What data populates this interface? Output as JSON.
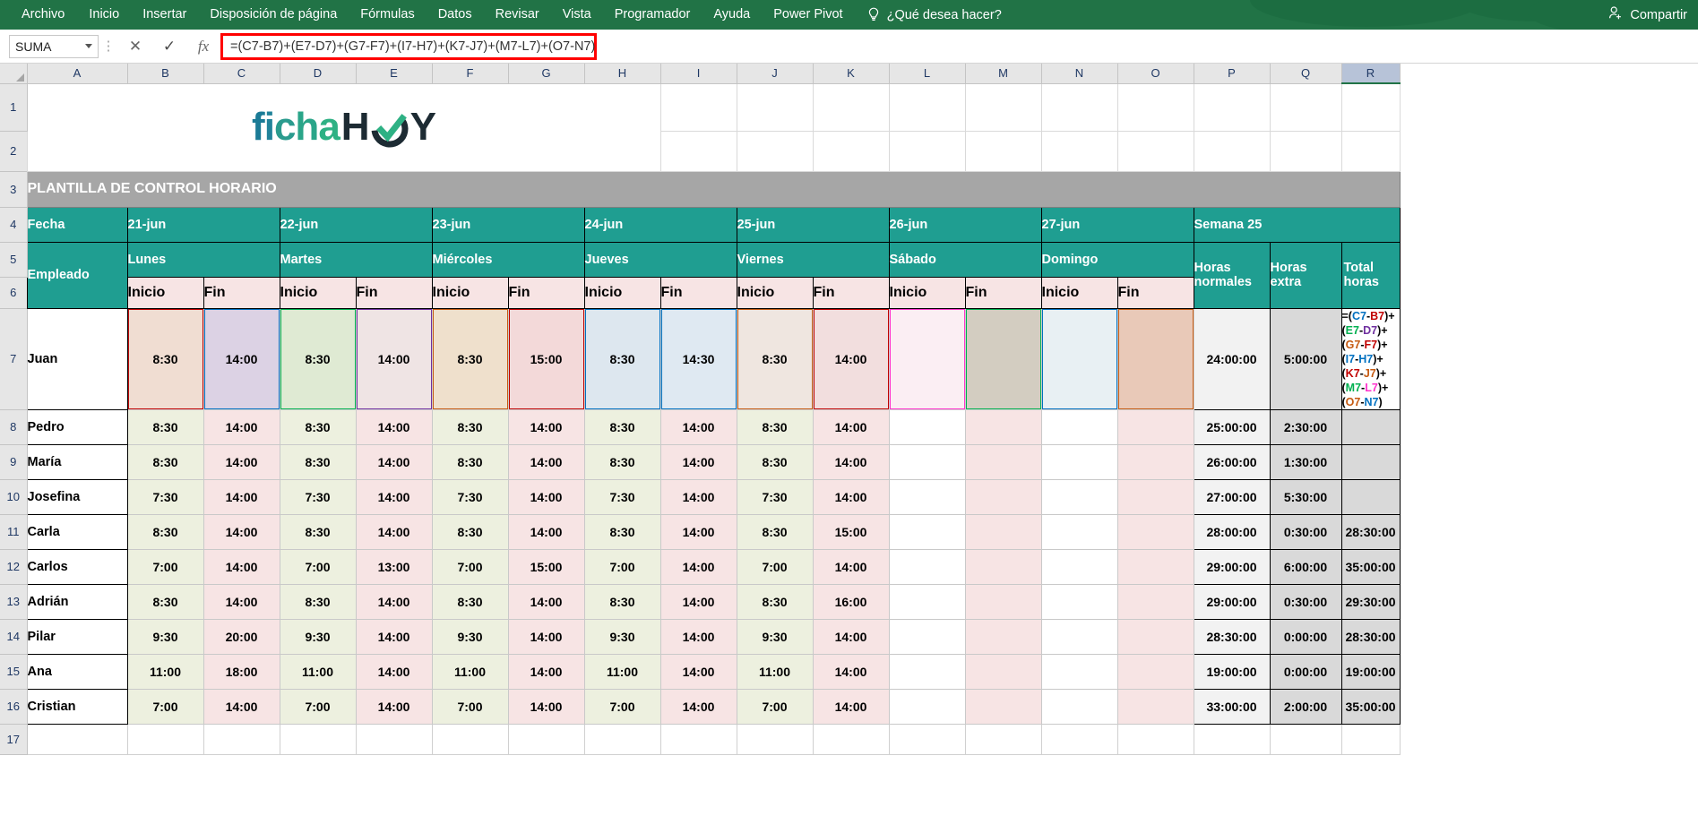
{
  "ribbon": {
    "tabs": [
      "Archivo",
      "Inicio",
      "Insertar",
      "Disposición de página",
      "Fórmulas",
      "Datos",
      "Revisar",
      "Vista",
      "Programador",
      "Ayuda",
      "Power Pivot"
    ],
    "tell_me": "¿Qué desea hacer?",
    "bulb_icon": "lightbulb-icon",
    "share_label": "Compartir",
    "share_icon": "person-add-icon",
    "accent_color": "#217346"
  },
  "formula_bar": {
    "name_box_value": "SUMA",
    "cancel_icon": "cancel-x-icon",
    "confirm_icon": "confirm-check-icon",
    "function_icon": "insert-function-icon",
    "formula": "=(C7-B7)+(E7-D7)+(G7-F7)+(I7-H7)+(K7-J7)+(M7-L7)+(O7-N7)",
    "highlight_color": "#ff0000"
  },
  "grid": {
    "columns": [
      "A",
      "B",
      "C",
      "D",
      "E",
      "F",
      "G",
      "H",
      "I",
      "J",
      "K",
      "L",
      "M",
      "N",
      "O",
      "P",
      "Q",
      "R"
    ],
    "selected_column": "R",
    "rows": [
      "1",
      "2",
      "3",
      "4",
      "5",
      "6",
      "7",
      "8",
      "9",
      "10",
      "11",
      "12",
      "13",
      "14",
      "15",
      "16",
      "17"
    ]
  },
  "sheet": {
    "logo": {
      "text_light": "ficha",
      "text_dark": "H",
      "text_mark": "O",
      "text_end": "Y"
    },
    "title": "PLANTILLA DE CONTROL HORARIO",
    "header_row_date_label": "Fecha",
    "header_row_employee_label": "Empleado",
    "dates": [
      "21-jun",
      "22-jun",
      "23-jun",
      "24-jun",
      "25-jun",
      "26-jun",
      "27-jun"
    ],
    "weekdays": [
      "Lunes",
      "Martes",
      "Miércoles",
      "Jueves",
      "Viernes",
      "Sábado",
      "Domingo"
    ],
    "week_label": "Semana 25",
    "subheaders": [
      "Inicio",
      "Fin"
    ],
    "summary_headers": [
      "Horas normales",
      "Horas extra",
      "Total horas"
    ],
    "r7_formula_parts": [
      {
        "t": "=(",
        "c": "#000000"
      },
      {
        "t": "C7",
        "c": "#0070c0"
      },
      {
        "t": "-",
        "c": "#000000"
      },
      {
        "t": "B7",
        "c": "#c00000"
      },
      {
        "t": ")+(",
        "c": "#000000"
      },
      {
        "t": "E7",
        "c": "#00b050"
      },
      {
        "t": "-",
        "c": "#000000"
      },
      {
        "t": "D7",
        "c": "#7030a0"
      },
      {
        "t": ")+(",
        "c": "#000000"
      },
      {
        "t": "G7",
        "c": "#c55a11"
      },
      {
        "t": "-",
        "c": "#000000"
      },
      {
        "t": "F7",
        "c": "#c00000"
      },
      {
        "t": ")+(",
        "c": "#000000"
      },
      {
        "t": "I7",
        "c": "#0070c0"
      },
      {
        "t": "-",
        "c": "#000000"
      },
      {
        "t": "H7",
        "c": "#0070c0"
      },
      {
        "t": ")+(",
        "c": "#000000"
      },
      {
        "t": "K7",
        "c": "#c00000"
      },
      {
        "t": "-",
        "c": "#000000"
      },
      {
        "t": "J7",
        "c": "#c55a11"
      },
      {
        "t": ")+(",
        "c": "#000000"
      },
      {
        "t": "M7",
        "c": "#00b050"
      },
      {
        "t": "-",
        "c": "#000000"
      },
      {
        "t": "L7",
        "c": "#ff33cc"
      },
      {
        "t": ")+(",
        "c": "#000000"
      },
      {
        "t": "O7",
        "c": "#c55a11"
      },
      {
        "t": "-",
        "c": "#000000"
      },
      {
        "t": "N7",
        "c": "#0070c0"
      },
      {
        "t": ")",
        "c": "#000000"
      }
    ],
    "employees": [
      {
        "name": "Juan",
        "times": [
          "8:30",
          "14:00",
          "8:30",
          "14:00",
          "8:30",
          "15:00",
          "8:30",
          "14:30",
          "8:30",
          "14:00",
          "",
          "",
          "",
          ""
        ],
        "normales": "24:00:00",
        "extra": "5:00:00",
        "total": ""
      },
      {
        "name": "Pedro",
        "times": [
          "8:30",
          "14:00",
          "8:30",
          "14:00",
          "8:30",
          "14:00",
          "8:30",
          "14:00",
          "8:30",
          "14:00",
          "",
          "",
          "",
          ""
        ],
        "normales": "25:00:00",
        "extra": "2:30:00",
        "total": ""
      },
      {
        "name": "María",
        "times": [
          "8:30",
          "14:00",
          "8:30",
          "14:00",
          "8:30",
          "14:00",
          "8:30",
          "14:00",
          "8:30",
          "14:00",
          "",
          "",
          "",
          ""
        ],
        "normales": "26:00:00",
        "extra": "1:30:00",
        "total": ""
      },
      {
        "name": "Josefina",
        "times": [
          "7:30",
          "14:00",
          "7:30",
          "14:00",
          "7:30",
          "14:00",
          "7:30",
          "14:00",
          "7:30",
          "14:00",
          "",
          "",
          "",
          ""
        ],
        "normales": "27:00:00",
        "extra": "5:30:00",
        "total": ""
      },
      {
        "name": "Carla",
        "times": [
          "8:30",
          "14:00",
          "8:30",
          "14:00",
          "8:30",
          "14:00",
          "8:30",
          "14:00",
          "8:30",
          "15:00",
          "",
          "",
          "",
          ""
        ],
        "normales": "28:00:00",
        "extra": "0:30:00",
        "total": "28:30:00"
      },
      {
        "name": "Carlos",
        "times": [
          "7:00",
          "14:00",
          "7:00",
          "13:00",
          "7:00",
          "15:00",
          "7:00",
          "14:00",
          "7:00",
          "14:00",
          "",
          "",
          "",
          ""
        ],
        "normales": "29:00:00",
        "extra": "6:00:00",
        "total": "35:00:00"
      },
      {
        "name": "Adrián",
        "times": [
          "8:30",
          "14:00",
          "8:30",
          "14:00",
          "8:30",
          "14:00",
          "8:30",
          "14:00",
          "8:30",
          "16:00",
          "",
          "",
          "",
          ""
        ],
        "normales": "29:00:00",
        "extra": "0:30:00",
        "total": "29:30:00"
      },
      {
        "name": "Pilar",
        "times": [
          "9:30",
          "20:00",
          "9:30",
          "14:00",
          "9:30",
          "14:00",
          "9:30",
          "14:00",
          "9:30",
          "14:00",
          "",
          "",
          "",
          ""
        ],
        "normales": "28:30:00",
        "extra": "0:00:00",
        "total": "28:30:00"
      },
      {
        "name": "Ana",
        "times": [
          "11:00",
          "18:00",
          "11:00",
          "14:00",
          "11:00",
          "14:00",
          "11:00",
          "14:00",
          "11:00",
          "14:00",
          "",
          "",
          "",
          ""
        ],
        "normales": "19:00:00",
        "extra": "0:00:00",
        "total": "19:00:00"
      },
      {
        "name": "Cristian",
        "times": [
          "7:00",
          "14:00",
          "7:00",
          "14:00",
          "7:00",
          "14:00",
          "7:00",
          "14:00",
          "7:00",
          "14:00",
          "",
          "",
          "",
          ""
        ],
        "normales": "33:00:00",
        "extra": "2:00:00",
        "total": "35:00:00"
      }
    ]
  }
}
